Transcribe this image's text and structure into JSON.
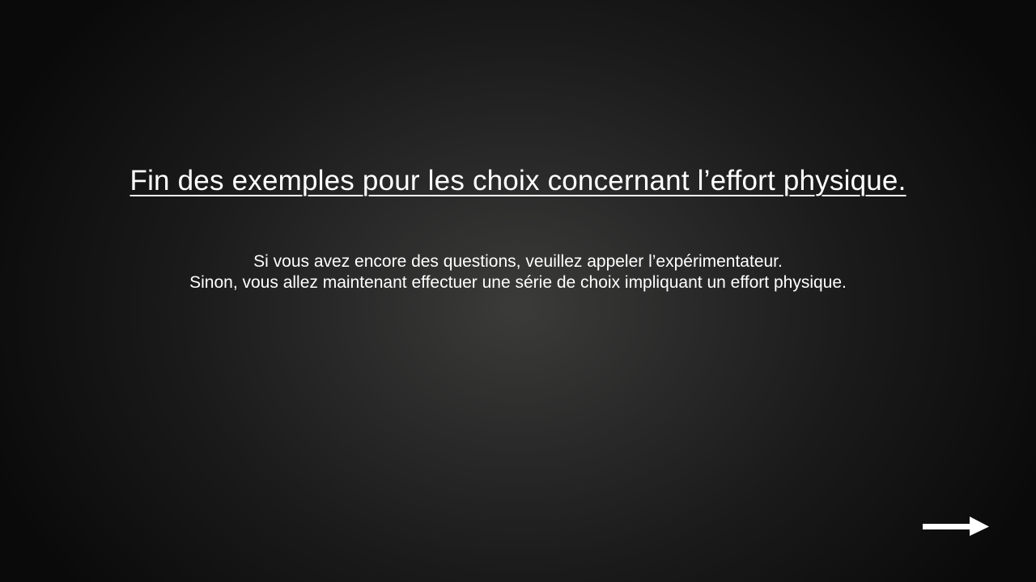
{
  "slide": {
    "title": "Fin des exemples pour les choix concernant l’effort physique.",
    "body_lines": [
      "Si vous avez encore des questions, veuillez appeler l’expérimentateur.",
      "Sinon, vous allez maintenant effectuer une série de choix impliquant un effort physique."
    ],
    "next_icon": "right-arrow-icon"
  },
  "colors": {
    "text": "#ffffff",
    "background_center": "#3b3b39",
    "background_edge": "#0a0a0a"
  }
}
